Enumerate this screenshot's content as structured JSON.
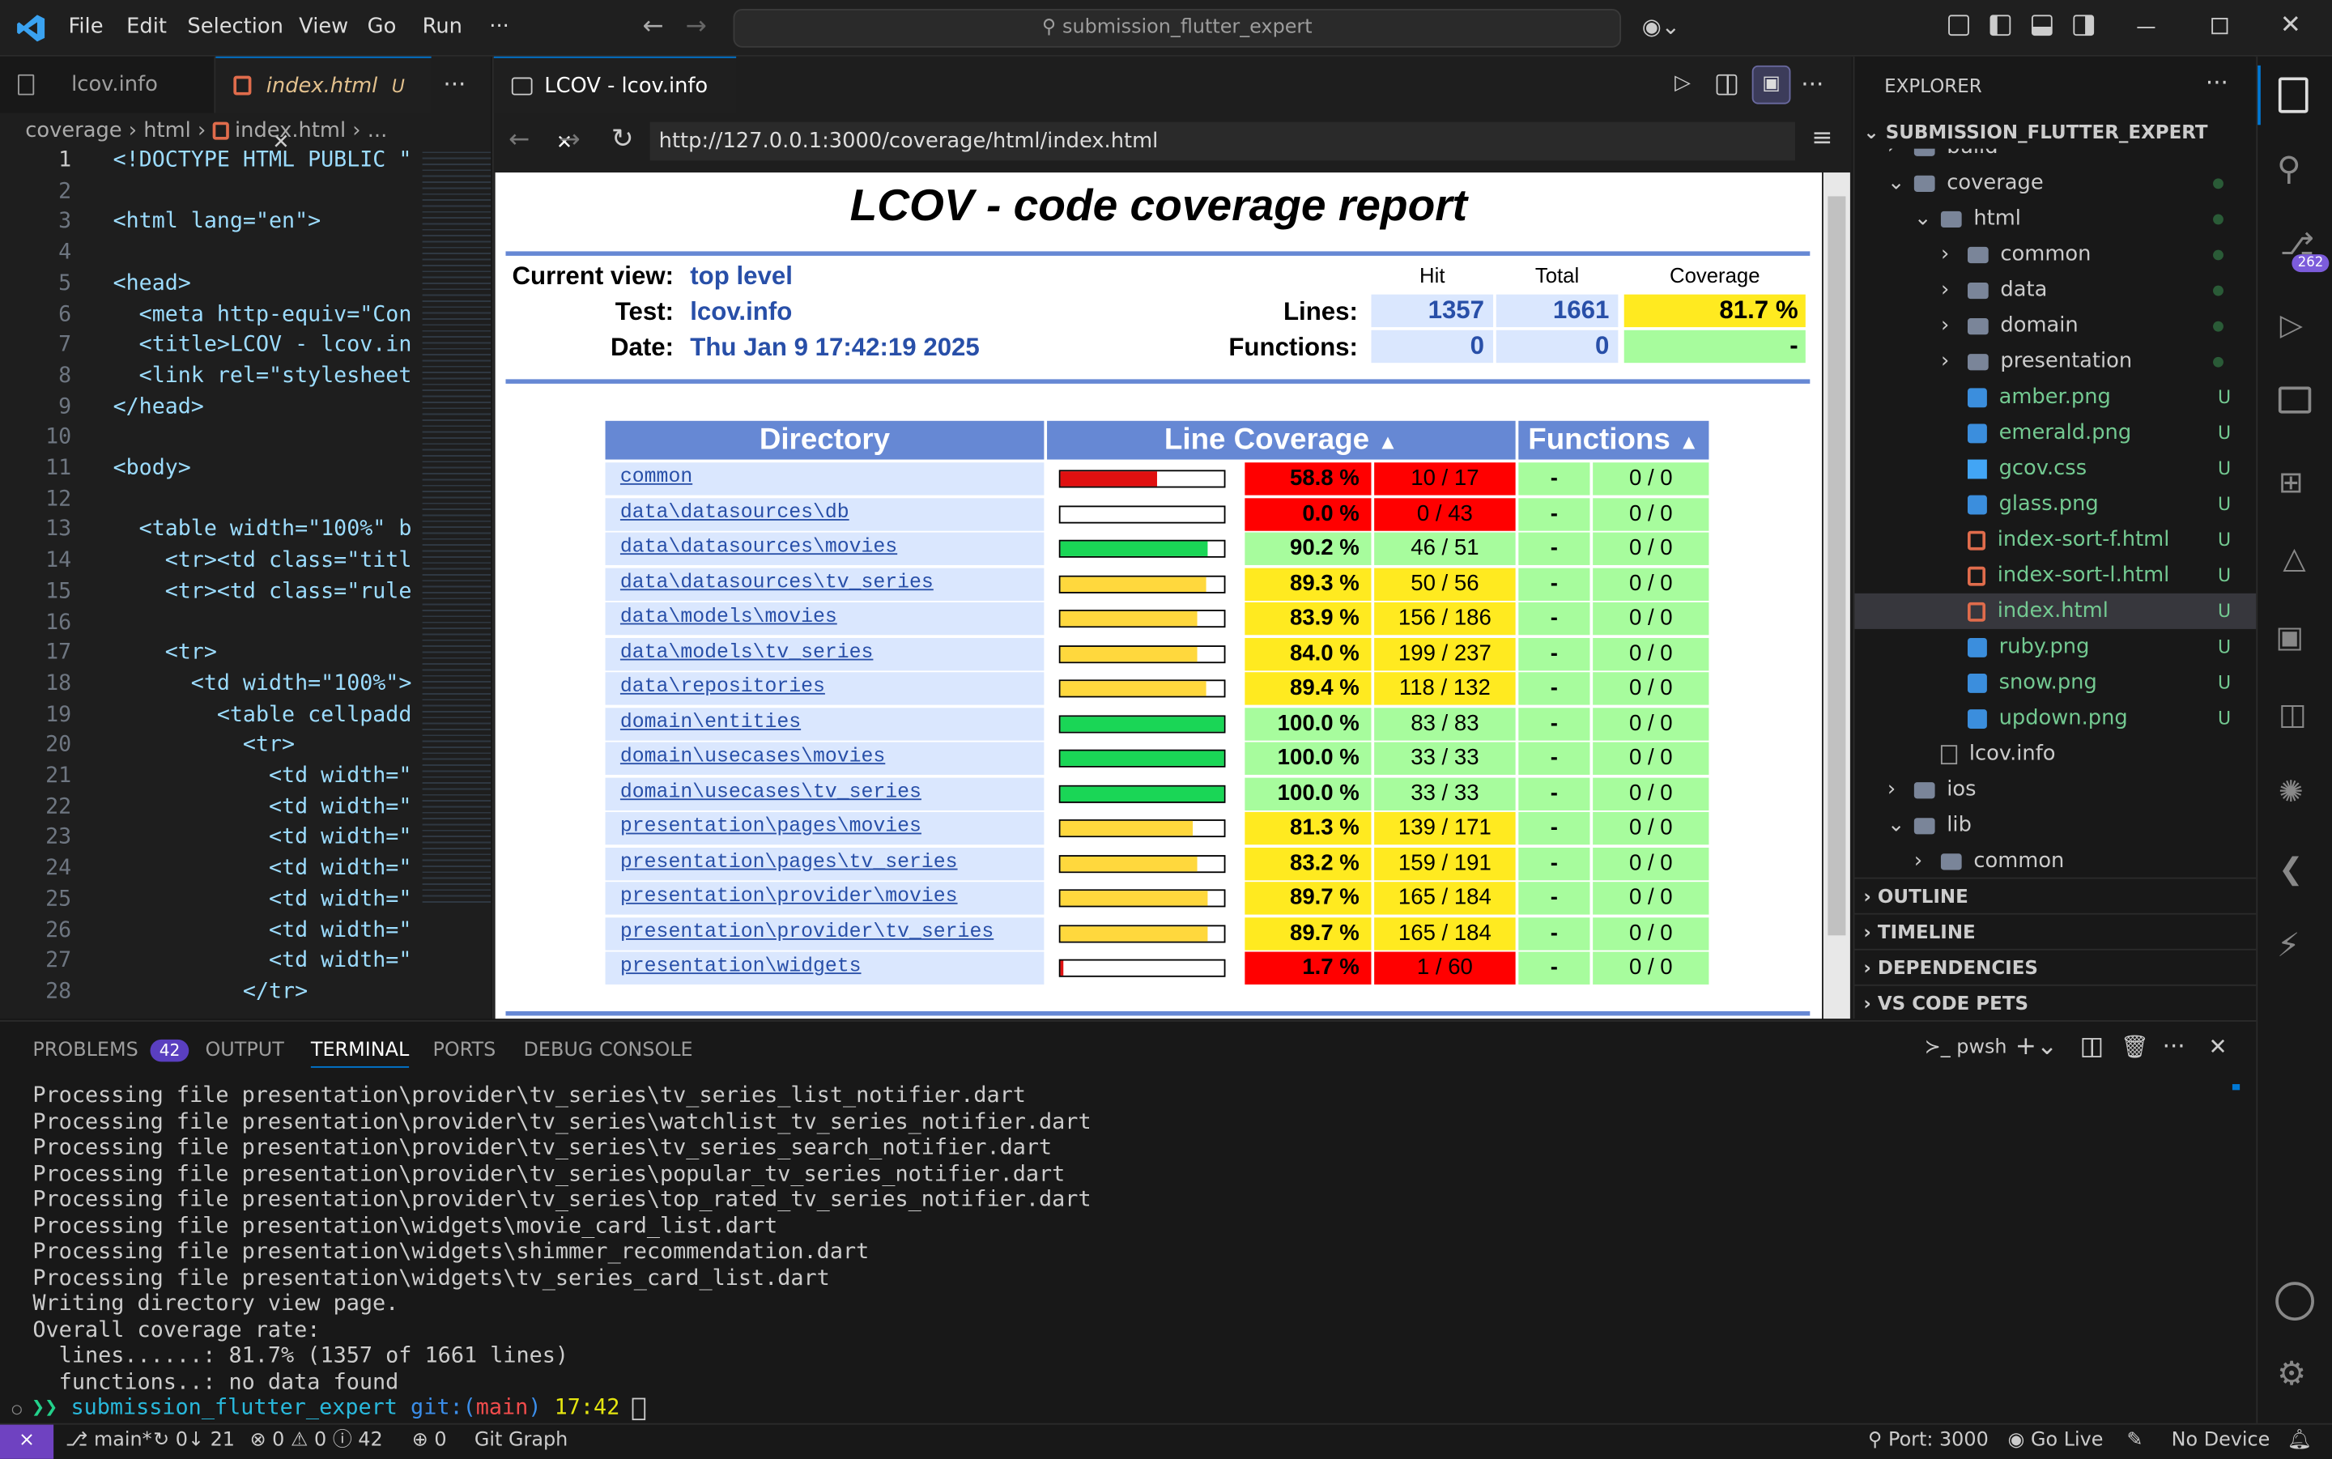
{
  "titlebar": {
    "menus": [
      "File",
      "Edit",
      "Selection",
      "View",
      "Go",
      "Run",
      "···"
    ],
    "command_center": "submission_flutter_expert"
  },
  "editor": {
    "tabs": [
      {
        "label": "lcov.info"
      },
      {
        "label": "index.html",
        "badge": "U"
      }
    ],
    "breadcrumb": [
      "coverage",
      "html",
      "index.html",
      "..."
    ],
    "lines": [
      {
        "n": "1",
        "t": "<!DOCTYPE HTML PUBLIC \""
      },
      {
        "n": "2",
        "t": ""
      },
      {
        "n": "3",
        "t": "<html lang=\"en\">"
      },
      {
        "n": "4",
        "t": ""
      },
      {
        "n": "5",
        "t": "<head>"
      },
      {
        "n": "6",
        "t": "  <meta http-equiv=\"Con"
      },
      {
        "n": "7",
        "t": "  <title>LCOV - lcov.in"
      },
      {
        "n": "8",
        "t": "  <link rel=\"stylesheet"
      },
      {
        "n": "9",
        "t": "</head>"
      },
      {
        "n": "10",
        "t": ""
      },
      {
        "n": "11",
        "t": "<body>"
      },
      {
        "n": "12",
        "t": ""
      },
      {
        "n": "13",
        "t": "  <table width=\"100%\" b"
      },
      {
        "n": "14",
        "t": "    <tr><td class=\"titl"
      },
      {
        "n": "15",
        "t": "    <tr><td class=\"rule"
      },
      {
        "n": "16",
        "t": ""
      },
      {
        "n": "17",
        "t": "    <tr>"
      },
      {
        "n": "18",
        "t": "      <td width=\"100%\">"
      },
      {
        "n": "19",
        "t": "        <table cellpadd"
      },
      {
        "n": "20",
        "t": "          <tr>"
      },
      {
        "n": "21",
        "t": "            <td width=\""
      },
      {
        "n": "22",
        "t": "            <td width=\""
      },
      {
        "n": "23",
        "t": "            <td width=\""
      },
      {
        "n": "24",
        "t": "            <td width=\""
      },
      {
        "n": "25",
        "t": "            <td width=\""
      },
      {
        "n": "26",
        "t": "            <td width=\""
      },
      {
        "n": "27",
        "t": "            <td width=\""
      },
      {
        "n": "28",
        "t": "          </tr>"
      }
    ]
  },
  "preview": {
    "tab_label": "LCOV - lcov.info",
    "url": "http://127.0.0.1:3000/coverage/html/index.html",
    "report": {
      "title": "LCOV - code coverage report",
      "current_view_label": "Current view:",
      "current_view": "top level",
      "test_label": "Test:",
      "test": "lcov.info",
      "date_label": "Date:",
      "date": "Thu Jan 9 17:42:19 2025",
      "hit_h": "Hit",
      "total_h": "Total",
      "coverage_h": "Coverage",
      "lines_label": "Lines:",
      "lines_hit": "1357",
      "lines_total": "1661",
      "lines_cov": "81.7 %",
      "func_label": "Functions:",
      "func_hit": "0",
      "func_total": "0",
      "func_cov": "-",
      "col_directory": "Directory",
      "col_line": "Line Coverage",
      "col_func": "Functions",
      "rows": [
        {
          "dir": "common",
          "pct": "58.8 %",
          "frac": "10 / 17",
          "level": "lo",
          "fill": 0.588,
          "f1": "-",
          "f2": "0 / 0"
        },
        {
          "dir": "data\\datasources\\db",
          "pct": "0.0 %",
          "frac": "0 / 43",
          "level": "lo",
          "fill": 0,
          "f1": "-",
          "f2": "0 / 0"
        },
        {
          "dir": "data\\datasources\\movies",
          "pct": "90.2 %",
          "frac": "46 / 51",
          "level": "hi",
          "fill": 0.902,
          "f1": "-",
          "f2": "0 / 0"
        },
        {
          "dir": "data\\datasources\\tv_series",
          "pct": "89.3 %",
          "frac": "50 / 56",
          "level": "med",
          "fill": 0.893,
          "f1": "-",
          "f2": "0 / 0"
        },
        {
          "dir": "data\\models\\movies",
          "pct": "83.9 %",
          "frac": "156 / 186",
          "level": "med",
          "fill": 0.839,
          "f1": "-",
          "f2": "0 / 0"
        },
        {
          "dir": "data\\models\\tv_series",
          "pct": "84.0 %",
          "frac": "199 / 237",
          "level": "med",
          "fill": 0.84,
          "f1": "-",
          "f2": "0 / 0"
        },
        {
          "dir": "data\\repositories",
          "pct": "89.4 %",
          "frac": "118 / 132",
          "level": "med",
          "fill": 0.894,
          "f1": "-",
          "f2": "0 / 0"
        },
        {
          "dir": "domain\\entities",
          "pct": "100.0 %",
          "frac": "83 / 83",
          "level": "hi",
          "fill": 1,
          "f1": "-",
          "f2": "0 / 0"
        },
        {
          "dir": "domain\\usecases\\movies",
          "pct": "100.0 %",
          "frac": "33 / 33",
          "level": "hi",
          "fill": 1,
          "f1": "-",
          "f2": "0 / 0"
        },
        {
          "dir": "domain\\usecases\\tv_series",
          "pct": "100.0 %",
          "frac": "33 / 33",
          "level": "hi",
          "fill": 1,
          "f1": "-",
          "f2": "0 / 0"
        },
        {
          "dir": "presentation\\pages\\movies",
          "pct": "81.3 %",
          "frac": "139 / 171",
          "level": "med",
          "fill": 0.813,
          "f1": "-",
          "f2": "0 / 0"
        },
        {
          "dir": "presentation\\pages\\tv_series",
          "pct": "83.2 %",
          "frac": "159 / 191",
          "level": "med",
          "fill": 0.832,
          "f1": "-",
          "f2": "0 / 0"
        },
        {
          "dir": "presentation\\provider\\movies",
          "pct": "89.7 %",
          "frac": "165 / 184",
          "level": "med",
          "fill": 0.897,
          "f1": "-",
          "f2": "0 / 0"
        },
        {
          "dir": "presentation\\provider\\tv_series",
          "pct": "89.7 %",
          "frac": "165 / 184",
          "level": "med",
          "fill": 0.897,
          "f1": "-",
          "f2": "0 / 0"
        },
        {
          "dir": "presentation\\widgets",
          "pct": "1.7 %",
          "frac": "1 / 60",
          "level": "lo",
          "fill": 0.017,
          "f1": "-",
          "f2": "0 / 0"
        }
      ]
    }
  },
  "explorer": {
    "title": "EXPLORER",
    "root": "SUBMISSION_FLUTTER_EXPERT",
    "items": [
      {
        "label": "build",
        "indent": 1,
        "kind": "folder",
        "chev": "right"
      },
      {
        "label": "coverage",
        "indent": 1,
        "kind": "folder",
        "chev": "down",
        "mark": "dot"
      },
      {
        "label": "html",
        "indent": 2,
        "kind": "folder",
        "chev": "down",
        "mark": "dot"
      },
      {
        "label": "common",
        "indent": 3,
        "kind": "folder",
        "chev": "right",
        "mark": "dot"
      },
      {
        "label": "data",
        "indent": 3,
        "kind": "folder",
        "chev": "right",
        "mark": "dot"
      },
      {
        "label": "domain",
        "indent": 3,
        "kind": "folder",
        "chev": "right",
        "mark": "dot"
      },
      {
        "label": "presentation",
        "indent": 3,
        "kind": "folder",
        "chev": "right",
        "mark": "dot"
      },
      {
        "label": "amber.png",
        "indent": 3,
        "kind": "img",
        "mark": "U"
      },
      {
        "label": "emerald.png",
        "indent": 3,
        "kind": "img",
        "mark": "U"
      },
      {
        "label": "gcov.css",
        "indent": 3,
        "kind": "css",
        "mark": "U"
      },
      {
        "label": "glass.png",
        "indent": 3,
        "kind": "img",
        "mark": "U"
      },
      {
        "label": "index-sort-f.html",
        "indent": 3,
        "kind": "html",
        "mark": "U"
      },
      {
        "label": "index-sort-l.html",
        "indent": 3,
        "kind": "html",
        "mark": "U"
      },
      {
        "label": "index.html",
        "indent": 3,
        "kind": "html",
        "mark": "U",
        "selected": true
      },
      {
        "label": "ruby.png",
        "indent": 3,
        "kind": "img",
        "mark": "U"
      },
      {
        "label": "snow.png",
        "indent": 3,
        "kind": "img",
        "mark": "U"
      },
      {
        "label": "updown.png",
        "indent": 3,
        "kind": "img",
        "mark": "U"
      },
      {
        "label": "lcov.info",
        "indent": 2,
        "kind": "file"
      },
      {
        "label": "ios",
        "indent": 1,
        "kind": "folder",
        "chev": "right"
      },
      {
        "label": "lib",
        "indent": 1,
        "kind": "folder",
        "chev": "down"
      },
      {
        "label": "common",
        "indent": 2,
        "kind": "folder",
        "chev": "right"
      }
    ],
    "sections": [
      "OUTLINE",
      "TIMELINE",
      "DEPENDENCIES",
      "VS CODE PETS"
    ],
    "badge": "262"
  },
  "panel": {
    "tabs": [
      "PROBLEMS",
      "OUTPUT",
      "TERMINAL",
      "PORTS",
      "DEBUG CONSOLE"
    ],
    "problems_count": "42",
    "shell": "pwsh",
    "lines": [
      "Processing file presentation\\provider\\tv_series\\tv_series_list_notifier.dart",
      "Processing file presentation\\provider\\tv_series\\watchlist_tv_series_notifier.dart",
      "Processing file presentation\\provider\\tv_series\\tv_series_search_notifier.dart",
      "Processing file presentation\\provider\\tv_series\\popular_tv_series_notifier.dart",
      "Processing file presentation\\provider\\tv_series\\top_rated_tv_series_notifier.dart",
      "Processing file presentation\\widgets\\movie_card_list.dart",
      "Processing file presentation\\widgets\\shimmer_recommendation.dart",
      "Processing file presentation\\widgets\\tv_series_card_list.dart",
      "Writing directory view page.",
      "Overall coverage rate:",
      "  lines......: 81.7% (1357 of 1661 lines)",
      "  functions..: no data found"
    ],
    "prompt_dir": "submission_flutter_expert",
    "prompt_git": "git:(",
    "prompt_branch": "main",
    "prompt_close": ")",
    "prompt_time": "17:42"
  },
  "status": {
    "branch": "main*",
    "sync": "0↓ 21",
    "errors": "0",
    "warnings": "0",
    "infos": "42",
    "ports": "0",
    "git_graph": "Git Graph",
    "port": "Port: 3000",
    "go_live": "Go Live",
    "device": "No Device"
  }
}
